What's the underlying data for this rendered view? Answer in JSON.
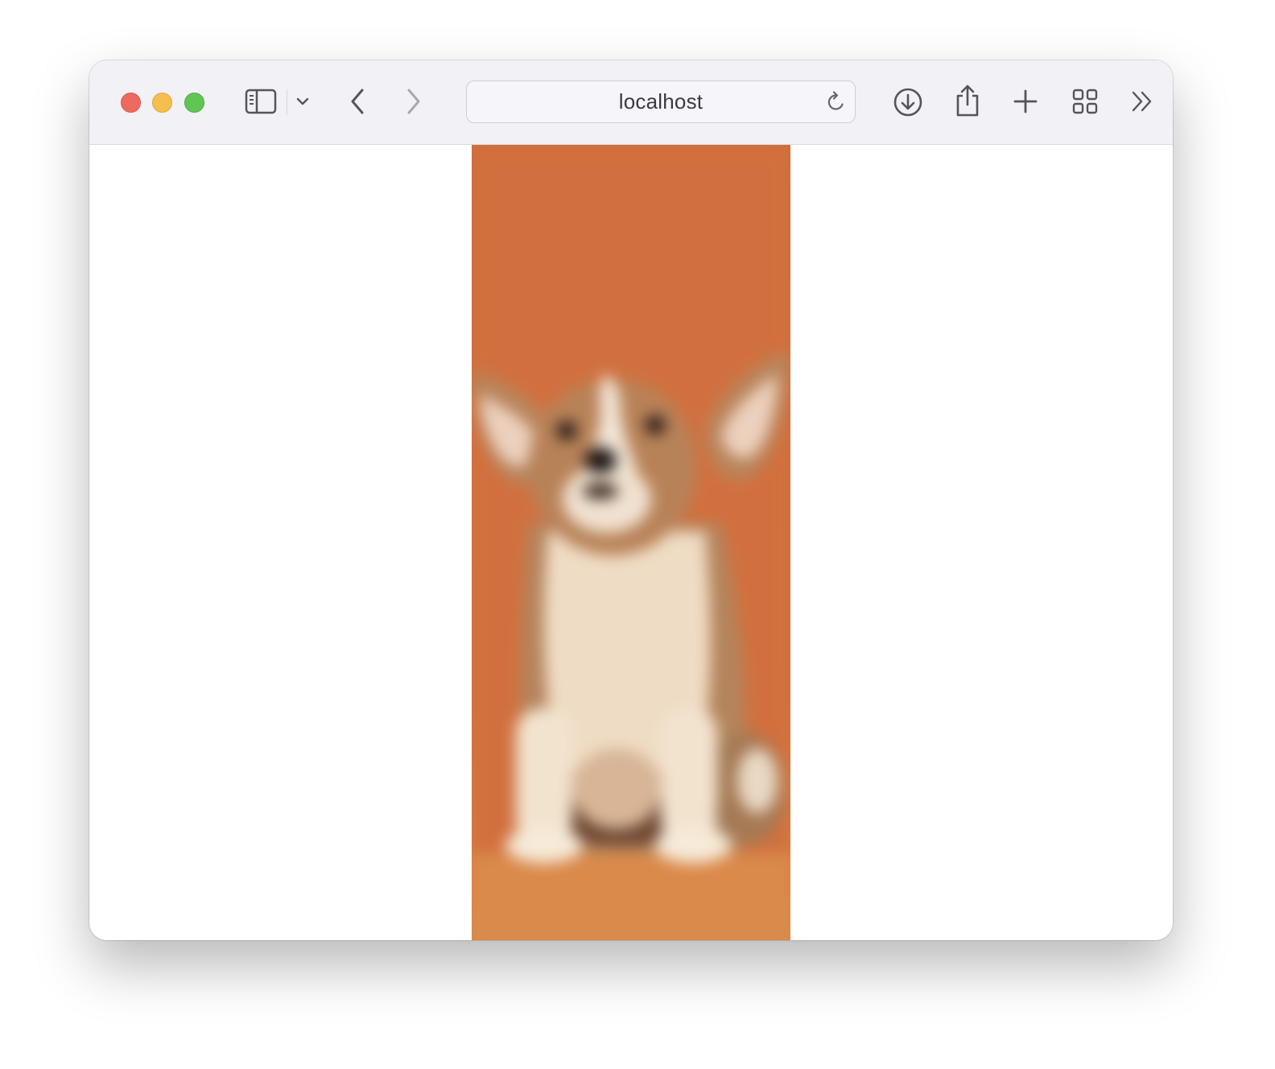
{
  "browser": {
    "address_text": "localhost",
    "icons": {
      "sidebar": "sidebar-icon",
      "sidebar_menu": "chevron-down-icon",
      "back": "chevron-left-icon",
      "forward": "chevron-right-icon",
      "reload": "reload-icon",
      "downloads": "download-icon",
      "share": "share-icon",
      "new_tab": "plus-icon",
      "tab_overview": "grid-icon",
      "more": "double-chevron-right-icon"
    },
    "colors": {
      "close": "#ec6a5e",
      "minimize": "#f5bf4f",
      "maximize": "#61c554"
    }
  },
  "page": {
    "image": {
      "subject": "puppy-photo",
      "background_color": "#d2713f"
    }
  }
}
